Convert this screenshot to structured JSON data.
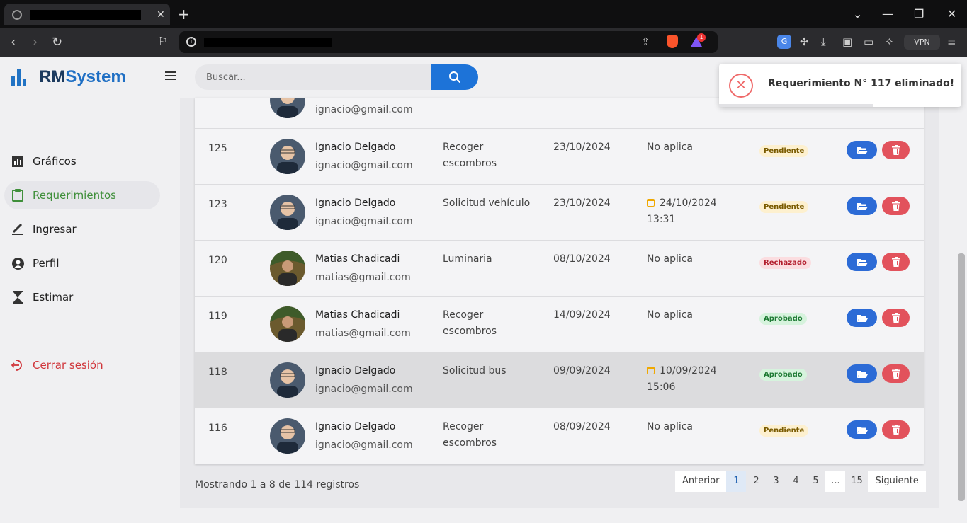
{
  "app": {
    "brand_rm": "RM",
    "brand_system": "System"
  },
  "search": {
    "placeholder": "Buscar..."
  },
  "sidebar": {
    "items": [
      {
        "label": "Gráficos",
        "icon": "bar-chart-icon"
      },
      {
        "label": "Requerimientos",
        "icon": "clipboard-icon",
        "active": true
      },
      {
        "label": "Ingresar",
        "icon": "pencil-icon"
      },
      {
        "label": "Perfil",
        "icon": "user-circle-icon"
      },
      {
        "label": "Estimar",
        "icon": "hourglass-icon"
      }
    ],
    "logout_label": "Cerrar sesión"
  },
  "table": {
    "partial_top_email": "ignacio@gmail.com",
    "rows": [
      {
        "id": "125",
        "name": "Ignacio Delgado",
        "email": "ignacio@gmail.com",
        "desc": "Recoger escombros",
        "date": "23/10/2024",
        "response": "No aplica",
        "response_date": false,
        "status": "Pendiente",
        "status_class": "pendiente",
        "avatar": "ignacio"
      },
      {
        "id": "123",
        "name": "Ignacio Delgado",
        "email": "ignacio@gmail.com",
        "desc": "Solicitud vehículo",
        "date": "23/10/2024",
        "response": "24/10/2024 13:31",
        "response_date": true,
        "status": "Pendiente",
        "status_class": "pendiente",
        "avatar": "ignacio"
      },
      {
        "id": "120",
        "name": "Matias Chadicadi",
        "email": "matias@gmail.com",
        "desc": "Luminaria",
        "date": "08/10/2024",
        "response": "No aplica",
        "response_date": false,
        "status": "Rechazado",
        "status_class": "rechazado",
        "avatar": "matias"
      },
      {
        "id": "119",
        "name": "Matias Chadicadi",
        "email": "matias@gmail.com",
        "desc": "Recoger escombros",
        "date": "14/09/2024",
        "response": "No aplica",
        "response_date": false,
        "status": "Aprobado",
        "status_class": "aprobado",
        "avatar": "matias"
      },
      {
        "id": "118",
        "name": "Ignacio Delgado",
        "email": "ignacio@gmail.com",
        "desc": "Solicitud bus",
        "date": "09/09/2024",
        "response": "10/09/2024 15:06",
        "response_date": true,
        "status": "Aprobado",
        "status_class": "aprobado",
        "avatar": "ignacio",
        "highlight": true
      },
      {
        "id": "116",
        "name": "Ignacio Delgado",
        "email": "ignacio@gmail.com",
        "desc": "Recoger escombros",
        "date": "08/09/2024",
        "response": "No aplica",
        "response_date": false,
        "status": "Pendiente",
        "status_class": "pendiente",
        "avatar": "ignacio"
      }
    ]
  },
  "footer": {
    "summary": "Mostrando 1 a 8 de 114 registros"
  },
  "pagination": {
    "prev": "Anterior",
    "pages": [
      "1",
      "2",
      "3",
      "4",
      "5",
      "...",
      "15"
    ],
    "current": "1",
    "next": "Siguiente"
  },
  "toast": {
    "message": "Requerimiento N° 117 eliminado!",
    "icon": "error-x-icon"
  },
  "browser": {
    "vpn_label": "VPN",
    "rewards_badge": "1"
  },
  "colors": {
    "accent": "#1d73d8",
    "active_nav": "#3f8f3a",
    "logout": "#d0353a",
    "delete": "#e2525c"
  }
}
